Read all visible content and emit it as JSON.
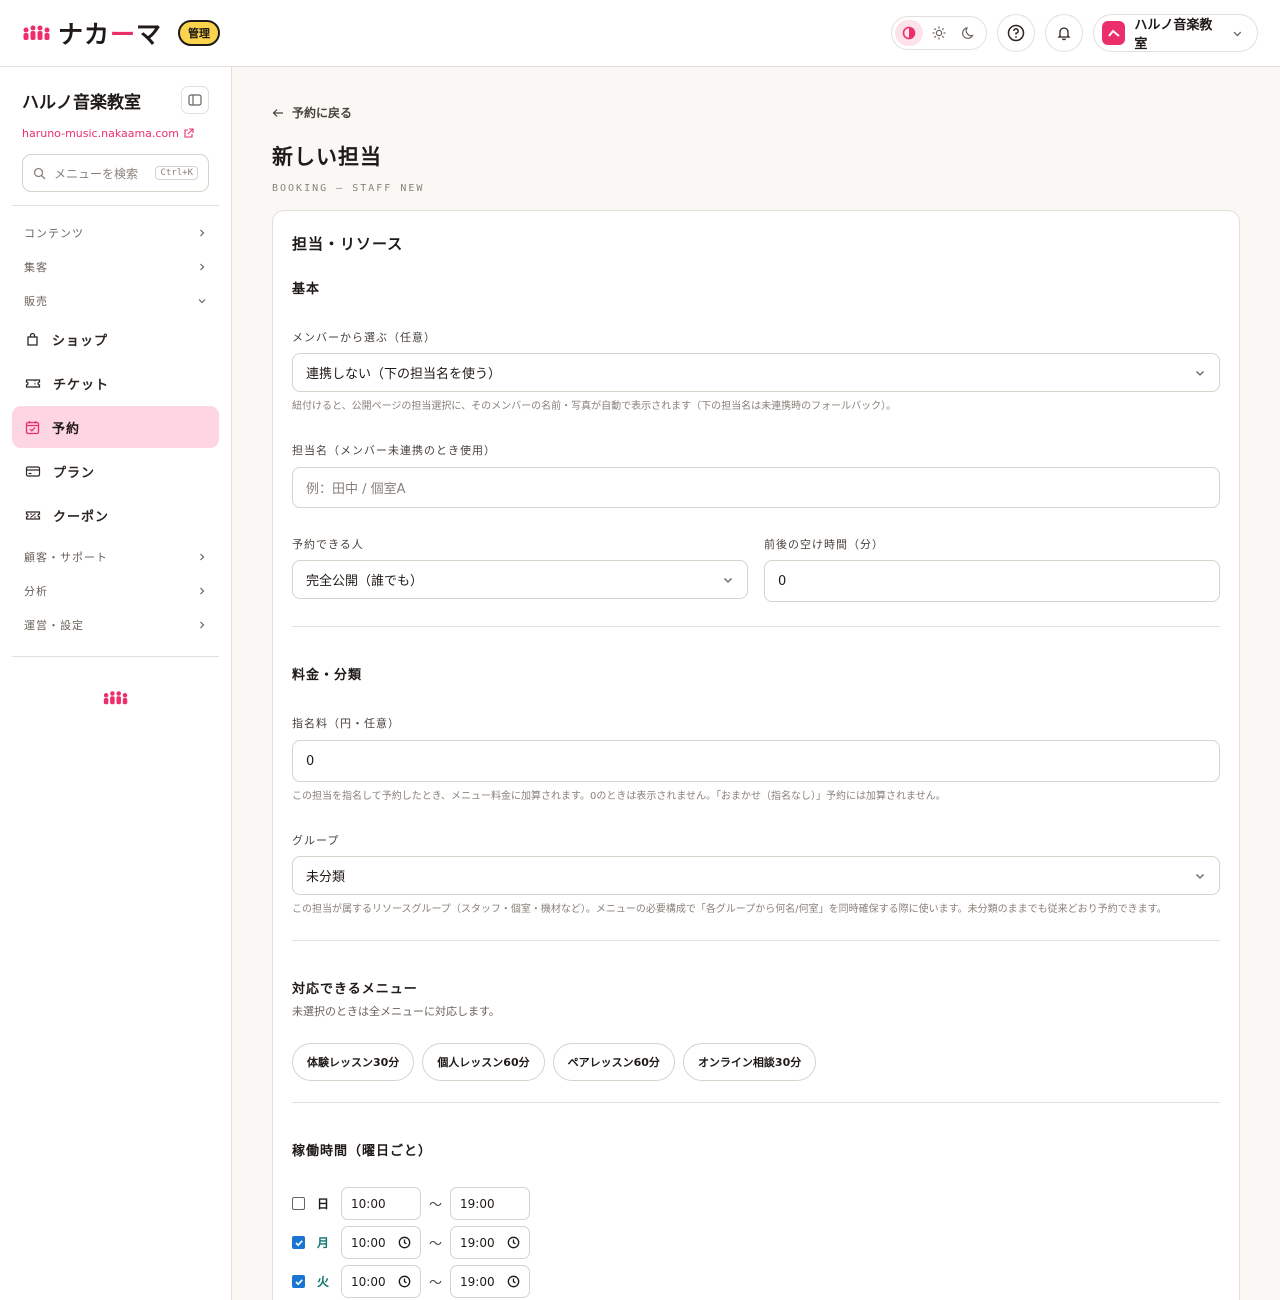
{
  "header": {
    "brand": "ナカーマ",
    "brand_before": "ナカ",
    "brand_dash": "ー",
    "brand_after": "マ",
    "admin_badge": "管理",
    "account_name": "ハルノ音楽教室",
    "brand_color": "#ec2f6b",
    "icons": [
      "contrast-icon",
      "sun-icon",
      "moon-icon",
      "help-icon",
      "bell-icon",
      "chevron-down-icon"
    ]
  },
  "sidebar": {
    "title": "ハルノ音楽教室",
    "url": "haruno-music.nakaama.com",
    "search_placeholder": "メニューを検索",
    "search_shortcut": "Ctrl+K",
    "sections": {
      "contents": "コンテンツ",
      "marketing": "集客",
      "sales": "販売",
      "support": "顧客・サポート",
      "analytics": "分析",
      "settings": "運営・設定"
    },
    "items": {
      "shop": "ショップ",
      "ticket": "チケット",
      "booking": "予約",
      "plan": "プラン",
      "coupon": "クーポン"
    },
    "active_item": "予約"
  },
  "main": {
    "back_label": "予約に戻る",
    "title": "新しい担当",
    "subtitle": "BOOKING — STAFF NEW",
    "card_title": "担当・リソース",
    "basic": {
      "heading": "基本",
      "member_label": "メンバーから選ぶ（任意）",
      "member_value": "連携しない（下の担当名を使う）",
      "member_help": "紐付けると、公開ページの担当選択に、そのメンバーの名前・写真が自動で表示されます（下の担当名は未連携時のフォールバック）。",
      "name_label": "担当名（メンバー未連携のとき使用）",
      "name_placeholder": "例：田中 / 個室A",
      "who_label": "予約できる人",
      "who_value": "完全公開（誰でも）",
      "buffer_label": "前後の空け時間（分）",
      "buffer_value": "0"
    },
    "pricing": {
      "heading": "料金・分類",
      "fee_label": "指名料（円・任意）",
      "fee_value": "0",
      "fee_help": "この担当を指名して予約したとき、メニュー料金に加算されます。0のときは表示されません。「おまかせ（指名なし）」予約には加算されません。",
      "group_label": "グループ",
      "group_value": "未分類",
      "group_help": "この担当が属するリソースグループ（スタッフ・個室・機材など）。メニューの必要構成で「各グループから何名/何室」を同時確保する際に使います。未分類のままでも従来どおり予約できます。"
    },
    "menus": {
      "heading": "対応できるメニュー",
      "help": "未選択のときは全メニューに対応します。",
      "chips": [
        "体験レッスン30分",
        "個人レッスン60分",
        "ペアレッスン60分",
        "オンライン相談30分"
      ]
    },
    "hours": {
      "heading": "稼働時間（曜日ごと）",
      "separator": "〜",
      "rows": [
        {
          "day": "日",
          "checked": false,
          "start": "10:00",
          "end": "19:00"
        },
        {
          "day": "月",
          "checked": true,
          "start": "10:00",
          "end": "19:00"
        },
        {
          "day": "火",
          "checked": true,
          "start": "10:00",
          "end": "19:00"
        }
      ]
    }
  }
}
